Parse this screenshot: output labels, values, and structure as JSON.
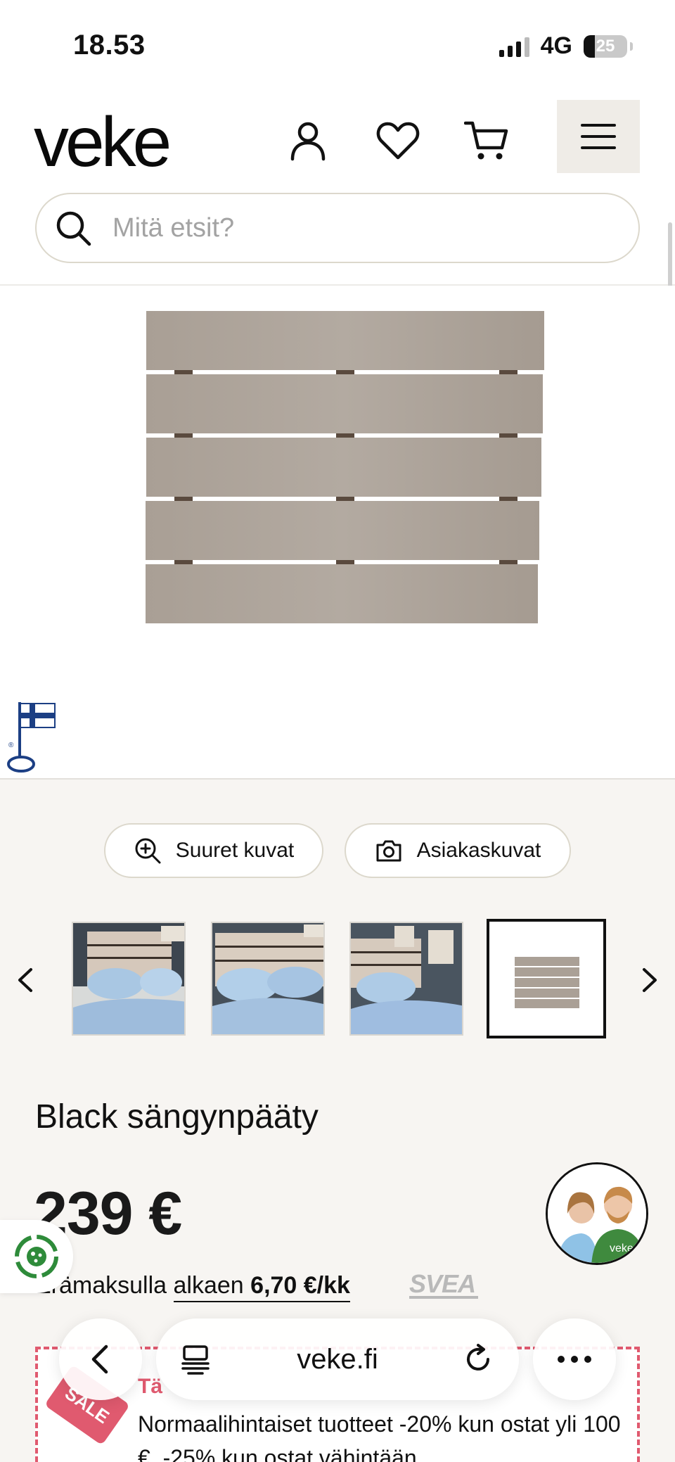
{
  "status": {
    "time": "18.53",
    "network": "4G",
    "battery": "25",
    "battery_level": 0.25
  },
  "header": {
    "logo": "veke"
  },
  "search": {
    "placeholder": "Mitä etsit?"
  },
  "gallery": {
    "large_images": "Suuret kuvat",
    "customer_images": "Asiakaskuvat"
  },
  "product": {
    "title": "Black sängynpääty",
    "price": "239 €",
    "installment_prefix": "Erämaksulla ",
    "installment_link": "alkaen ",
    "installment_amount": "6,70 €/kk",
    "installment_provider": "SVEA"
  },
  "chat": {
    "badge_text": "veke"
  },
  "sale": {
    "tag": "SALE",
    "title": "Tä",
    "text": "Normaalihintaiset tuotteet -20% kun ostat yli 100 €, -25% kun ostat vähintään"
  },
  "browser": {
    "url": "veke.fi"
  },
  "icons": [
    "account-icon",
    "heart-icon",
    "cart-icon",
    "menu-icon",
    "search-icon",
    "zoom-icon",
    "camera-icon",
    "chevron-left-icon",
    "chevron-right-icon",
    "back-icon",
    "tabs-icon",
    "reload-icon",
    "more-icon",
    "finnish-flag-key-icon",
    "eco-icon"
  ]
}
